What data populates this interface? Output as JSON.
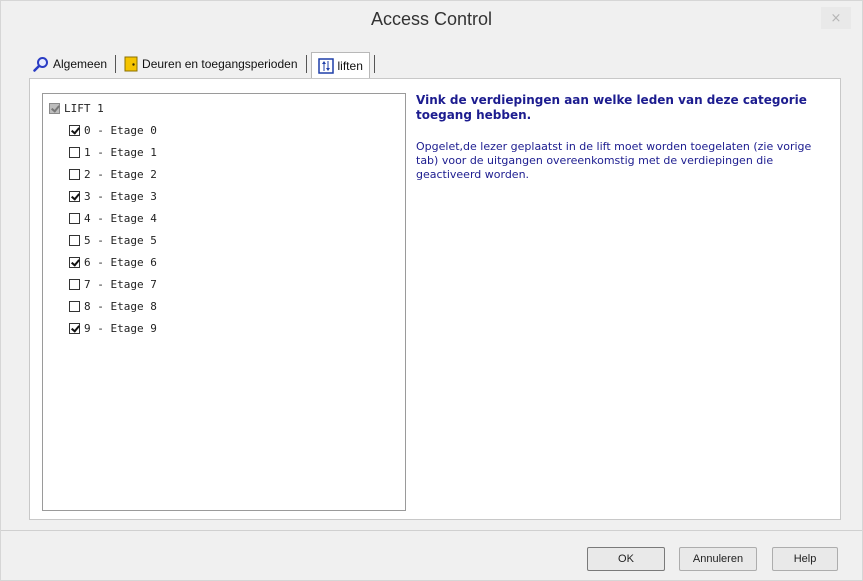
{
  "window": {
    "title": "Access Control",
    "close_glyph": "×"
  },
  "tabs": [
    {
      "label": "Algemeen",
      "icon": "magnifier-icon"
    },
    {
      "label": "Deuren en toegangsperioden",
      "icon": "door-icon"
    },
    {
      "label": "liften",
      "icon": "elevator-icon",
      "active": true
    }
  ],
  "tree": {
    "root": {
      "label": "LIFT 1",
      "state": "partial"
    },
    "items": [
      {
        "label": "0 - Etage 0",
        "checked": true
      },
      {
        "label": "1 - Etage 1",
        "checked": false
      },
      {
        "label": "2 - Etage 2",
        "checked": false
      },
      {
        "label": "3 - Etage 3",
        "checked": true
      },
      {
        "label": "4 - Etage 4",
        "checked": false
      },
      {
        "label": "5 - Etage 5",
        "checked": false
      },
      {
        "label": "6 - Etage 6",
        "checked": true
      },
      {
        "label": "7 - Etage 7",
        "checked": false
      },
      {
        "label": "8 - Etage 8",
        "checked": false
      },
      {
        "label": "9 - Etage 9",
        "checked": true
      }
    ]
  },
  "info": {
    "title": "Vink de verdiepingen aan welke leden van deze categorie toegang hebben.",
    "text": "Opgelet,de lezer geplaatst in de lift moet worden toegelaten (zie vorige tab) voor de uitgangen overeenkomstig met de verdiepingen die geactiveerd worden."
  },
  "buttons": {
    "ok": "OK",
    "cancel": "Annuleren",
    "help": "Help"
  },
  "colors": {
    "info_text": "#1c1c8f",
    "background": "#f0f0f0"
  }
}
